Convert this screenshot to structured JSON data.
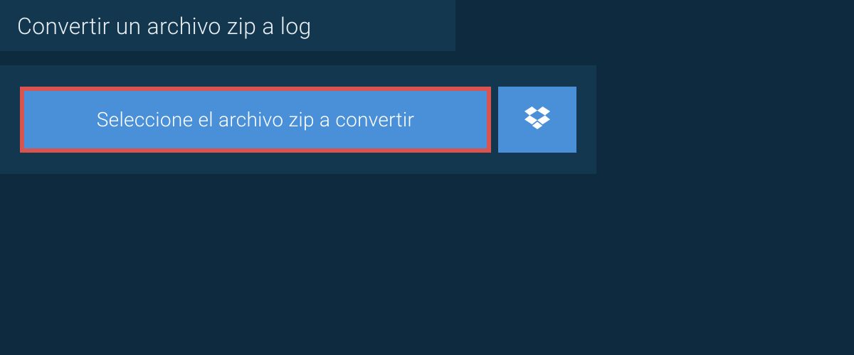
{
  "title": "Convertir un archivo zip a log",
  "upload": {
    "select_label": "Seleccione el archivo zip a convertir"
  },
  "colors": {
    "page_bg": "#0e2a3f",
    "panel_bg": "#143750",
    "button_bg": "#4a90d9",
    "highlight_border": "#d9534f",
    "text_light": "#ffffff"
  }
}
